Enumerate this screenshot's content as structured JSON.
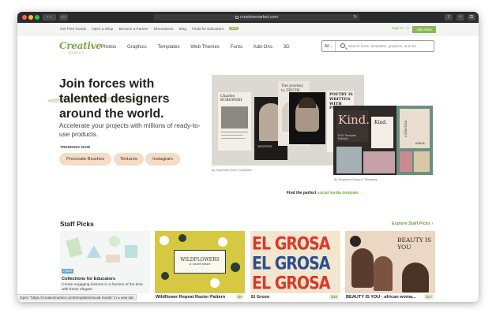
{
  "browser": {
    "url": "creativemarket.com",
    "status_text": "Open \"https://creativemarket.com/templates/social-media\" in a new tab"
  },
  "topbar": {
    "links": [
      "Get Free Goods",
      "Open a Shop",
      "Become a Partner",
      "Discussions",
      "Blog",
      "Finds for Educators"
    ],
    "new_badge": "NEW",
    "sign_in": "Sign In",
    "separator": "or",
    "join": "Join Now"
  },
  "nav": {
    "logo": "Creative",
    "logo_sub": "MARKET",
    "items": [
      "Photos",
      "Graphics",
      "Templates",
      "Web Themes",
      "Fonts",
      "Add-Ons",
      "3D"
    ],
    "search_scope": "All",
    "search_placeholder": "Search fonts, templates, graphics, and mo"
  },
  "hero": {
    "title_line1": "Join forces with",
    "title_line2": "talented designers",
    "title_line3": "around the world.",
    "subtitle": "Accelerate your projects with millions of ready-to-use products.",
    "trending_label": "TRENDING NOW",
    "trending": [
      "Procreate Brushes",
      "Textures",
      "Instagram"
    ],
    "caption_left": "By September Silk in Templates",
    "caption_right": "By Simplanna Studio in Templates",
    "find_text": "Find the perfect",
    "find_link": "social media template",
    "find_arrow": "→",
    "collage_texts": {
      "bukowski": "Charles BUKOWSKI",
      "journey": "The journey to TRUTH",
      "poetry": "POETRY IS WRITTEN WITH PASSION",
      "writers": "WRITERS",
      "kind": "Kind.",
      "kind_small": "Kind.",
      "kind_template": "PSD Template Editable",
      "collection": "collection",
      "kinda": "KINDA"
    }
  },
  "staff_picks": {
    "title": "Staff Picks",
    "explore": "Explore Staff Picks",
    "explore_arrow": "›",
    "products": [
      {
        "name": "Collections for Educators",
        "badge": "FINDS",
        "desc": "Create engaging lessons in a fraction of the time with these elegant",
        "price": ""
      },
      {
        "name": "Wildflower Repeat Raster Pattern",
        "price": "$4",
        "art": "WILDFLOWERS",
        "art_sub": "& sweet petals"
      },
      {
        "name": "El Groso",
        "price": "$18",
        "art": "EL GROSA"
      },
      {
        "name": "BEAUTY IS YOU - african woma...",
        "price": "$17",
        "art": "BEAUTY IS YOU"
      }
    ]
  },
  "colors": {
    "brand_green": "#7ba84a",
    "pill_bg": "#f6dcc5",
    "join_btn": "#8cb85a",
    "grosa_red": "#d93a2b",
    "grosa_blue": "#2b4f8f"
  }
}
